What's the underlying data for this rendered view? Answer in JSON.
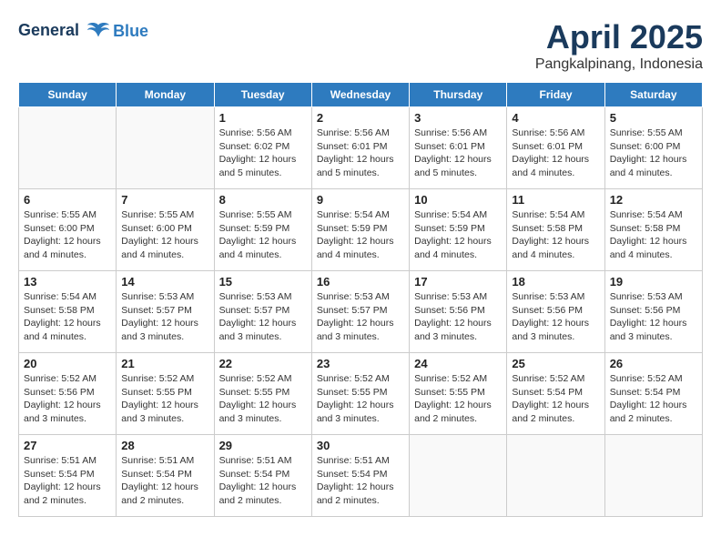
{
  "logo": {
    "line1": "General",
    "line2": "Blue"
  },
  "title": "April 2025",
  "subtitle": "Pangkalpinang, Indonesia",
  "days_of_week": [
    "Sunday",
    "Monday",
    "Tuesday",
    "Wednesday",
    "Thursday",
    "Friday",
    "Saturday"
  ],
  "weeks": [
    [
      {
        "day": "",
        "info": ""
      },
      {
        "day": "",
        "info": ""
      },
      {
        "day": "1",
        "info": "Sunrise: 5:56 AM\nSunset: 6:02 PM\nDaylight: 12 hours\nand 5 minutes."
      },
      {
        "day": "2",
        "info": "Sunrise: 5:56 AM\nSunset: 6:01 PM\nDaylight: 12 hours\nand 5 minutes."
      },
      {
        "day": "3",
        "info": "Sunrise: 5:56 AM\nSunset: 6:01 PM\nDaylight: 12 hours\nand 5 minutes."
      },
      {
        "day": "4",
        "info": "Sunrise: 5:56 AM\nSunset: 6:01 PM\nDaylight: 12 hours\nand 4 minutes."
      },
      {
        "day": "5",
        "info": "Sunrise: 5:55 AM\nSunset: 6:00 PM\nDaylight: 12 hours\nand 4 minutes."
      }
    ],
    [
      {
        "day": "6",
        "info": "Sunrise: 5:55 AM\nSunset: 6:00 PM\nDaylight: 12 hours\nand 4 minutes."
      },
      {
        "day": "7",
        "info": "Sunrise: 5:55 AM\nSunset: 6:00 PM\nDaylight: 12 hours\nand 4 minutes."
      },
      {
        "day": "8",
        "info": "Sunrise: 5:55 AM\nSunset: 5:59 PM\nDaylight: 12 hours\nand 4 minutes."
      },
      {
        "day": "9",
        "info": "Sunrise: 5:54 AM\nSunset: 5:59 PM\nDaylight: 12 hours\nand 4 minutes."
      },
      {
        "day": "10",
        "info": "Sunrise: 5:54 AM\nSunset: 5:59 PM\nDaylight: 12 hours\nand 4 minutes."
      },
      {
        "day": "11",
        "info": "Sunrise: 5:54 AM\nSunset: 5:58 PM\nDaylight: 12 hours\nand 4 minutes."
      },
      {
        "day": "12",
        "info": "Sunrise: 5:54 AM\nSunset: 5:58 PM\nDaylight: 12 hours\nand 4 minutes."
      }
    ],
    [
      {
        "day": "13",
        "info": "Sunrise: 5:54 AM\nSunset: 5:58 PM\nDaylight: 12 hours\nand 4 minutes."
      },
      {
        "day": "14",
        "info": "Sunrise: 5:53 AM\nSunset: 5:57 PM\nDaylight: 12 hours\nand 3 minutes."
      },
      {
        "day": "15",
        "info": "Sunrise: 5:53 AM\nSunset: 5:57 PM\nDaylight: 12 hours\nand 3 minutes."
      },
      {
        "day": "16",
        "info": "Sunrise: 5:53 AM\nSunset: 5:57 PM\nDaylight: 12 hours\nand 3 minutes."
      },
      {
        "day": "17",
        "info": "Sunrise: 5:53 AM\nSunset: 5:56 PM\nDaylight: 12 hours\nand 3 minutes."
      },
      {
        "day": "18",
        "info": "Sunrise: 5:53 AM\nSunset: 5:56 PM\nDaylight: 12 hours\nand 3 minutes."
      },
      {
        "day": "19",
        "info": "Sunrise: 5:53 AM\nSunset: 5:56 PM\nDaylight: 12 hours\nand 3 minutes."
      }
    ],
    [
      {
        "day": "20",
        "info": "Sunrise: 5:52 AM\nSunset: 5:56 PM\nDaylight: 12 hours\nand 3 minutes."
      },
      {
        "day": "21",
        "info": "Sunrise: 5:52 AM\nSunset: 5:55 PM\nDaylight: 12 hours\nand 3 minutes."
      },
      {
        "day": "22",
        "info": "Sunrise: 5:52 AM\nSunset: 5:55 PM\nDaylight: 12 hours\nand 3 minutes."
      },
      {
        "day": "23",
        "info": "Sunrise: 5:52 AM\nSunset: 5:55 PM\nDaylight: 12 hours\nand 3 minutes."
      },
      {
        "day": "24",
        "info": "Sunrise: 5:52 AM\nSunset: 5:55 PM\nDaylight: 12 hours\nand 2 minutes."
      },
      {
        "day": "25",
        "info": "Sunrise: 5:52 AM\nSunset: 5:54 PM\nDaylight: 12 hours\nand 2 minutes."
      },
      {
        "day": "26",
        "info": "Sunrise: 5:52 AM\nSunset: 5:54 PM\nDaylight: 12 hours\nand 2 minutes."
      }
    ],
    [
      {
        "day": "27",
        "info": "Sunrise: 5:51 AM\nSunset: 5:54 PM\nDaylight: 12 hours\nand 2 minutes."
      },
      {
        "day": "28",
        "info": "Sunrise: 5:51 AM\nSunset: 5:54 PM\nDaylight: 12 hours\nand 2 minutes."
      },
      {
        "day": "29",
        "info": "Sunrise: 5:51 AM\nSunset: 5:54 PM\nDaylight: 12 hours\nand 2 minutes."
      },
      {
        "day": "30",
        "info": "Sunrise: 5:51 AM\nSunset: 5:54 PM\nDaylight: 12 hours\nand 2 minutes."
      },
      {
        "day": "",
        "info": ""
      },
      {
        "day": "",
        "info": ""
      },
      {
        "day": "",
        "info": ""
      }
    ]
  ]
}
